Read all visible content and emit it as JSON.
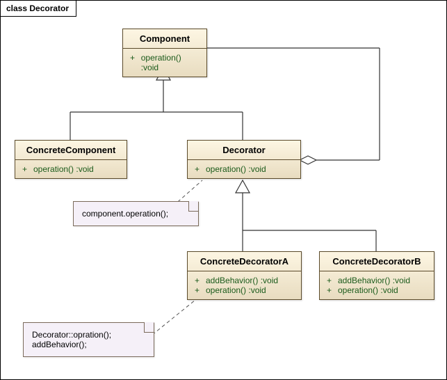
{
  "diagram_title": "class Decorator",
  "classes": {
    "component": {
      "name": "Component",
      "ops": [
        {
          "visibility": "+",
          "signature": "operation() :void"
        }
      ]
    },
    "concrete_component": {
      "name": "ConcreteComponent",
      "ops": [
        {
          "visibility": "+",
          "signature": "operation() :void"
        }
      ]
    },
    "decorator": {
      "name": "Decorator",
      "ops": [
        {
          "visibility": "+",
          "signature": "operation() :void"
        }
      ]
    },
    "concrete_decorator_a": {
      "name": "ConcreteDecoratorA",
      "ops": [
        {
          "visibility": "+",
          "signature": "addBehavior() :void"
        },
        {
          "visibility": "+",
          "signature": "operation() :void"
        }
      ]
    },
    "concrete_decorator_b": {
      "name": "ConcreteDecoratorB",
      "ops": [
        {
          "visibility": "+",
          "signature": "addBehavior() :void"
        },
        {
          "visibility": "+",
          "signature": "operation() :void"
        }
      ]
    }
  },
  "notes": {
    "decorator_note": {
      "lines": [
        "component.operation();"
      ]
    },
    "concrete_a_note": {
      "lines": [
        "Decorator::opration();",
        "addBehavior();"
      ]
    }
  },
  "relationships": [
    {
      "type": "generalization",
      "from": "ConcreteComponent",
      "to": "Component"
    },
    {
      "type": "generalization",
      "from": "Decorator",
      "to": "Component"
    },
    {
      "type": "generalization",
      "from": "ConcreteDecoratorA",
      "to": "Decorator"
    },
    {
      "type": "generalization",
      "from": "ConcreteDecoratorB",
      "to": "Decorator"
    },
    {
      "type": "aggregation",
      "from": "Decorator",
      "to": "Component"
    }
  ]
}
